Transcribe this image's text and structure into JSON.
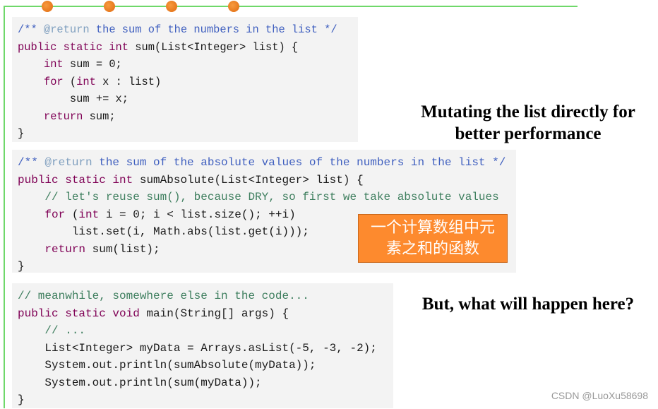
{
  "decor": {
    "accent": "#6fd86a",
    "dot_color": "#ef7d22",
    "dots": 4
  },
  "code_blocks": [
    {
      "lines": [
        [
          [
            "jd",
            "/** "
          ],
          [
            "tag",
            "@return"
          ],
          [
            "jd",
            " the sum of the numbers in the list */"
          ]
        ],
        [
          [
            "kw",
            "public static int"
          ],
          [
            "pl",
            " sum(List<Integer> list) {"
          ]
        ],
        [
          [
            "pl",
            "    "
          ],
          [
            "kw",
            "int"
          ],
          [
            "pl",
            " sum = 0;"
          ]
        ],
        [
          [
            "pl",
            "    "
          ],
          [
            "kw",
            "for"
          ],
          [
            "pl",
            " ("
          ],
          [
            "kw",
            "int"
          ],
          [
            "pl",
            " x : list)"
          ]
        ],
        [
          [
            "pl",
            "        sum += x;"
          ]
        ],
        [
          [
            "pl",
            "    "
          ],
          [
            "kw",
            "return"
          ],
          [
            "pl",
            " sum;"
          ]
        ],
        [
          [
            "pl",
            "}"
          ]
        ]
      ]
    },
    {
      "lines": [
        [
          [
            "jd",
            "/** "
          ],
          [
            "tag",
            "@return"
          ],
          [
            "jd",
            " the sum of the absolute values of the numbers in the list */"
          ]
        ],
        [
          [
            "kw",
            "public static int"
          ],
          [
            "pl",
            " sumAbsolute(List<Integer> list) {"
          ]
        ],
        [
          [
            "pl",
            "    "
          ],
          [
            "cm",
            "// let's reuse sum(), because DRY, so first we take absolute values"
          ]
        ],
        [
          [
            "pl",
            "    "
          ],
          [
            "kw",
            "for"
          ],
          [
            "pl",
            " ("
          ],
          [
            "kw",
            "int"
          ],
          [
            "pl",
            " i = 0; i < list.size(); ++i)"
          ]
        ],
        [
          [
            "pl",
            "        list.set(i, Math.abs(list.get(i)));"
          ]
        ],
        [
          [
            "pl",
            "    "
          ],
          [
            "kw",
            "return"
          ],
          [
            "pl",
            " sum(list);"
          ]
        ],
        [
          [
            "pl",
            "}"
          ]
        ]
      ]
    },
    {
      "lines": [
        [
          [
            "cm",
            "// meanwhile, somewhere else in the code..."
          ]
        ],
        [
          [
            "kw",
            "public static void"
          ],
          [
            "pl",
            " main(String[] args) {"
          ]
        ],
        [
          [
            "pl",
            "    "
          ],
          [
            "cm",
            "// ..."
          ]
        ],
        [
          [
            "pl",
            "    List<Integer> myData = Arrays.asList(-5, -3, -2);"
          ]
        ],
        [
          [
            "pl",
            "    System.out.println(sumAbsolute(myData));"
          ]
        ],
        [
          [
            "pl",
            "    System.out.println(sum(myData));"
          ]
        ],
        [
          [
            "pl",
            "}"
          ]
        ]
      ]
    }
  ],
  "callout": {
    "line1": "一个计算数组中元",
    "line2": "素之和的函数",
    "color": "#fd8a2e"
  },
  "side_text": {
    "mutating_line1": "Mutating the list directly for",
    "mutating_line2": "better performance",
    "question": "But, what will happen here?"
  },
  "watermark": "CSDN @LuoXu58698"
}
